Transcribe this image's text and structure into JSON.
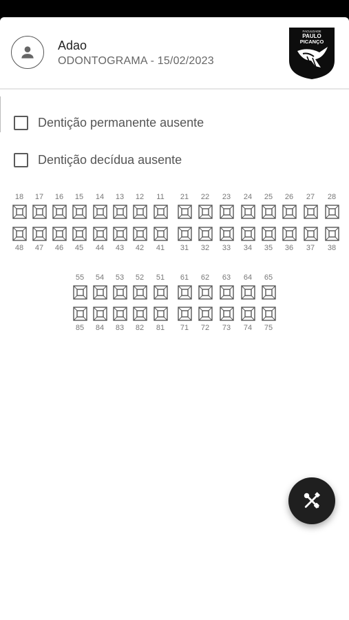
{
  "patient": {
    "name": "Adao",
    "subtitle": "ODONTOGRAMA - 15/02/2023"
  },
  "logo": {
    "line1": "FACULDADE",
    "line2": "PAULO",
    "line3": "PICANÇO"
  },
  "options": [
    {
      "label": "Dentição permanente ausente",
      "checked": false
    },
    {
      "label": "Dentição decídua ausente",
      "checked": false
    }
  ],
  "dentition": {
    "permanent_upper": [
      "18",
      "17",
      "16",
      "15",
      "14",
      "13",
      "12",
      "11",
      "21",
      "22",
      "23",
      "24",
      "25",
      "26",
      "27",
      "28"
    ],
    "permanent_lower": [
      "48",
      "47",
      "46",
      "45",
      "44",
      "43",
      "42",
      "41",
      "31",
      "32",
      "33",
      "34",
      "35",
      "36",
      "37",
      "38"
    ],
    "deciduous_upper": [
      "55",
      "54",
      "53",
      "52",
      "51",
      "61",
      "62",
      "63",
      "64",
      "65"
    ],
    "deciduous_lower": [
      "85",
      "84",
      "83",
      "82",
      "81",
      "71",
      "72",
      "73",
      "74",
      "75"
    ]
  },
  "icons": {
    "avatar": "person-icon",
    "fab": "tools-icon"
  }
}
